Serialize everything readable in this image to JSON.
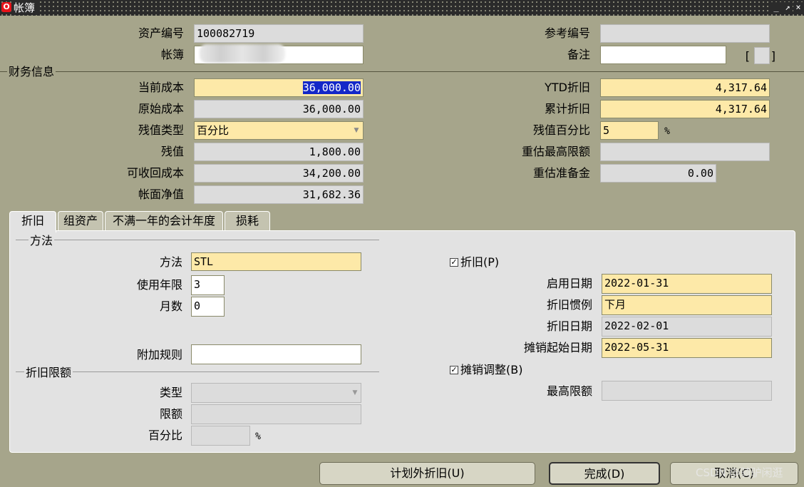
{
  "window": {
    "title": "帐簿",
    "icon": "oracle-icon",
    "controls": [
      "minimize-icon",
      "restore-icon",
      "close-icon"
    ]
  },
  "header": {
    "asset_number_label": "资产编号",
    "asset_number_value": "100082719",
    "book_label": "帐簿",
    "book_value": "",
    "reference_label": "参考编号",
    "reference_value": "",
    "comment_label": "备注",
    "comment_value": "",
    "bracket_left": "[",
    "bracket_right": "]"
  },
  "finance": {
    "section_label": "财务信息",
    "current_cost_label": "当前成本",
    "current_cost_value": "36,000.00",
    "original_cost_label": "原始成本",
    "original_cost_value": "36,000.00",
    "salvage_type_label": "残值类型",
    "salvage_type_value": "百分比",
    "salvage_value_label": "残值",
    "salvage_value_value": "1,800.00",
    "recoverable_cost_label": "可收回成本",
    "recoverable_cost_value": "34,200.00",
    "net_book_value_label": "帐面净值",
    "net_book_value_value": "31,682.36",
    "ytd_depr_label": "YTD折旧",
    "ytd_depr_value": "4,317.64",
    "accum_depr_label": "累计折旧",
    "accum_depr_value": "4,317.64",
    "salvage_pct_label": "残值百分比",
    "salvage_pct_value": "5",
    "pct_sign": "%",
    "reval_ceiling_label": "重估最高限额",
    "reval_ceiling_value": "",
    "reval_reserve_label": "重估准备金",
    "reval_reserve_value": "0.00"
  },
  "tabs": [
    {
      "label": "折旧",
      "active": true
    },
    {
      "label": "组资产",
      "active": false
    },
    {
      "label": "不满一年的会计年度",
      "active": false
    },
    {
      "label": "损耗",
      "active": false
    }
  ],
  "depreciation_tab": {
    "method_group_label": "方法",
    "method_label": "方法",
    "method_value": "STL",
    "life_years_label": "使用年限",
    "life_years_value": "3",
    "months_label": "月数",
    "months_value": "0",
    "bonus_rule_label": "附加规则",
    "bonus_rule_value": "",
    "limit_group_label": "折旧限额",
    "limit_type_label": "类型",
    "limit_type_value": "",
    "limit_amount_label": "限额",
    "limit_amount_value": "",
    "limit_pct_label": "百分比",
    "limit_pct_value": "",
    "limit_pct_sign": "%",
    "depreciate_checkbox_label": "折旧(P)",
    "depreciate_checked": true,
    "in_service_date_label": "启用日期",
    "in_service_date_value": "2022-01-31",
    "prorate_convention_label": "折旧惯例",
    "prorate_convention_value": "下月",
    "prorate_date_label": "折旧日期",
    "prorate_date_value": "2022-02-01",
    "amort_start_label": "摊销起始日期",
    "amort_start_value": "2022-05-31",
    "amortize_adj_label": "摊销调整(B)",
    "amortize_adj_checked": true,
    "ceiling_label": "最高限额",
    "ceiling_value": ""
  },
  "buttons": {
    "unplanned_label": "计划外折旧(U)",
    "done_label": "完成(D)",
    "cancel_label": "取消(C)"
  },
  "watermark": "CSDN @骑驴闲逛",
  "colors": {
    "background": "#a6a58b",
    "required_field": "#fde9a8",
    "readonly_field": "#dcdcdc",
    "selection": "#1428c8"
  }
}
